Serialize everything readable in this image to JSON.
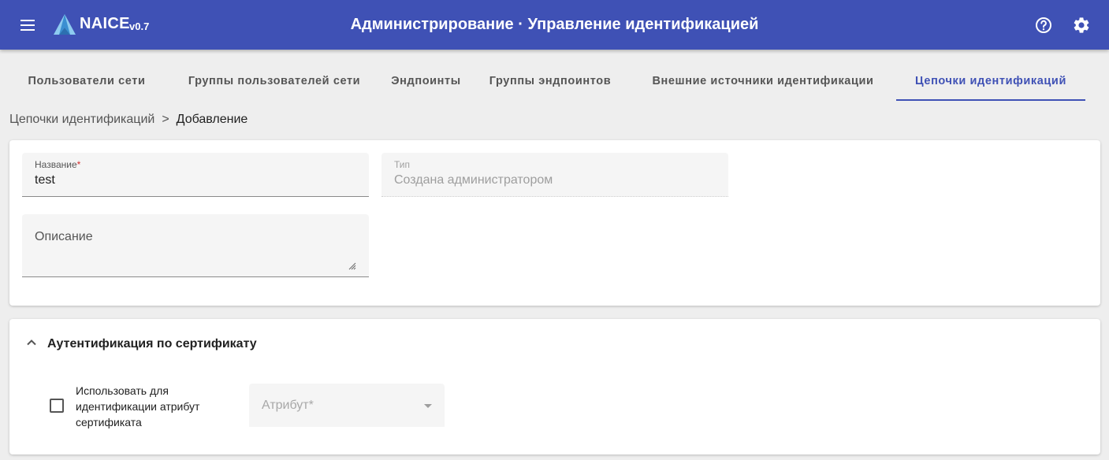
{
  "app": {
    "brand": "NAICE",
    "version": "v0.7",
    "page_title": "Администрирование · Управление идентификацией"
  },
  "header_icons": [
    "menu-icon",
    "logo-icon",
    "help-icon",
    "gear-icon"
  ],
  "tabs": [
    {
      "label": "Пользователи сети",
      "active": false
    },
    {
      "label": "Группы пользователей сети",
      "active": false
    },
    {
      "label": "Эндпоинты",
      "active": false
    },
    {
      "label": "Группы эндпоинтов",
      "active": false
    },
    {
      "label": "Внешние источники идентификации",
      "active": false
    },
    {
      "label": "Цепочки идентификаций",
      "active": true
    }
  ],
  "breadcrumb": {
    "parent": "Цепочки идентификаций",
    "separator": ">",
    "current": "Добавление"
  },
  "form": {
    "name": {
      "label": "Название",
      "required_mark": "*",
      "value": "test"
    },
    "type": {
      "label": "Тип",
      "value": "Создана администратором"
    },
    "description": {
      "placeholder": "Описание"
    }
  },
  "cert_section": {
    "title": "Аутентификация по сертификату",
    "checkbox_label": "Использовать для идентификации атрибут сертификата",
    "checkbox_checked": false,
    "attribute_placeholder": "Атрибут*"
  },
  "colors": {
    "primary": "#3f51b5",
    "background": "#eeeeee",
    "required": "#d32f2f"
  }
}
